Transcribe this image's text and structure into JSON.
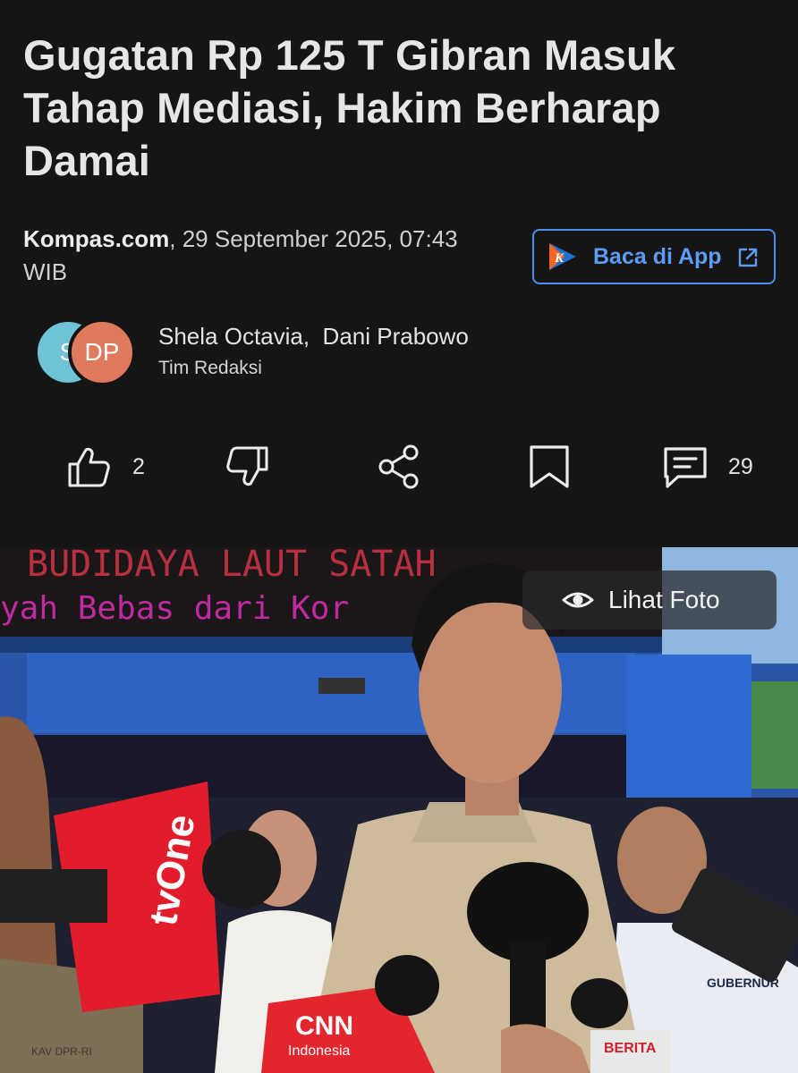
{
  "article": {
    "title": "Gugatan Rp 125 T Gibran Masuk Tahap Mediasi, Hakim Berharap Damai",
    "source": "Kompas.com",
    "date_time": ", 29 September 2025, 07:43 WIB"
  },
  "app_button": {
    "label": "Baca di App",
    "icon": "kompas-k-logo"
  },
  "authors": {
    "avatars": [
      "S",
      "DP"
    ],
    "names": "Shela Octavia,  Dani Prabowo",
    "team": "Tim Redaksi"
  },
  "actions": {
    "like_count": "2",
    "comment_count": "29"
  },
  "photo": {
    "view_label": "Lihat Foto",
    "scene_text": {
      "ticker_top": "BUDIDAYA LAUT SATAH",
      "ticker_bottom": "yah Bebas dari Kor",
      "mic_tvone": "tvOne",
      "mic_cnn": "CNN",
      "mic_cnn_sub": "Indonesia",
      "badge_gubernur": "GUBERNUR",
      "badge_berita": "BERITA",
      "badge_dpr": "KAV DPR-RI"
    }
  },
  "colors": {
    "background": "#151515",
    "accent_blue": "#4d8ff0",
    "avatar_s": "#6fc3d6",
    "avatar_dp": "#e07a5c"
  }
}
